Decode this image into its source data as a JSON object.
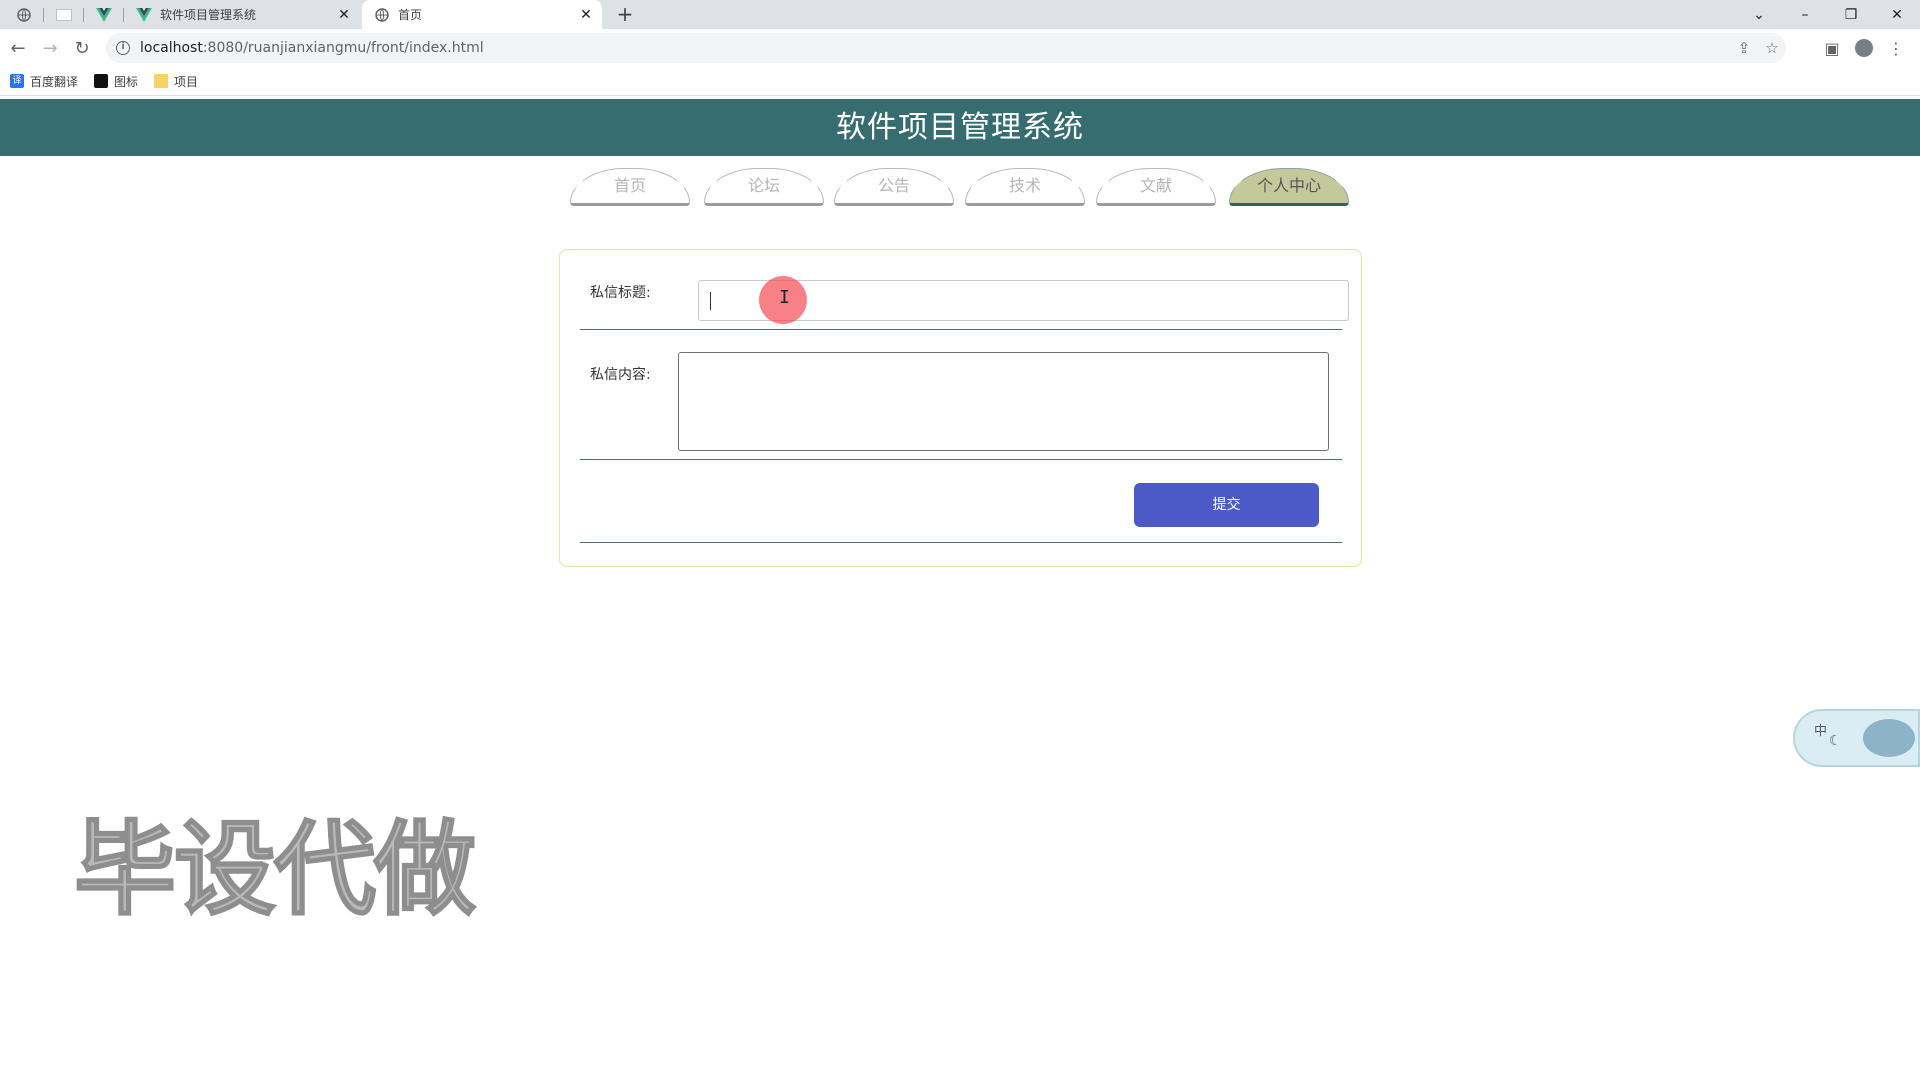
{
  "browser": {
    "tabs": [
      {
        "title": "",
        "favicon": "globe-icon"
      },
      {
        "title": "",
        "favicon": "blank-page-icon"
      },
      {
        "title": "",
        "favicon": "vue-icon"
      },
      {
        "title": "软件项目管理系统",
        "favicon": "vue-icon"
      },
      {
        "title": "首页",
        "favicon": "globe-icon"
      }
    ],
    "url_host": "localhost",
    "url_path": ":8080/ruanjianxiangmu/front/index.html",
    "bookmarks": [
      {
        "label": "百度翻译",
        "icon": "baidu-translate-icon",
        "icon_char": "译"
      },
      {
        "label": "图标",
        "icon": "image-icon",
        "icon_char": ""
      },
      {
        "label": "项目",
        "icon": "folder-icon",
        "icon_char": ""
      }
    ]
  },
  "site": {
    "title": "软件项目管理系统",
    "nav": [
      {
        "label": "首页",
        "active": false
      },
      {
        "label": "论坛",
        "active": false
      },
      {
        "label": "公告",
        "active": false
      },
      {
        "label": "技术",
        "active": false
      },
      {
        "label": "文献",
        "active": false
      },
      {
        "label": "个人中心",
        "active": true
      }
    ]
  },
  "form": {
    "title_label": "私信标题:",
    "title_value": "",
    "content_label": "私信内容:",
    "content_value": "",
    "submit_label": "提交"
  },
  "widget": {
    "lang": "中"
  },
  "watermark": "毕设代做",
  "colors": {
    "header": "#376d70",
    "nav_active": "#c3c99a",
    "submit": "#4c5ac8",
    "card_border": "#e6dfa8"
  }
}
